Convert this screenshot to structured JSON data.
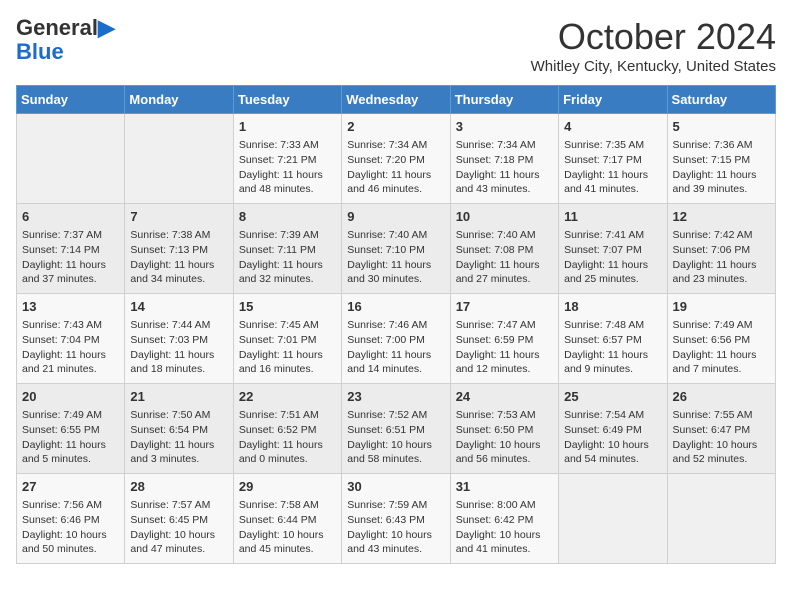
{
  "header": {
    "logo_general": "General",
    "logo_blue": "Blue",
    "month": "October 2024",
    "location": "Whitley City, Kentucky, United States"
  },
  "days_of_week": [
    "Sunday",
    "Monday",
    "Tuesday",
    "Wednesday",
    "Thursday",
    "Friday",
    "Saturday"
  ],
  "weeks": [
    [
      {
        "day": "",
        "info": ""
      },
      {
        "day": "",
        "info": ""
      },
      {
        "day": "1",
        "info": "Sunrise: 7:33 AM\nSunset: 7:21 PM\nDaylight: 11 hours\nand 48 minutes."
      },
      {
        "day": "2",
        "info": "Sunrise: 7:34 AM\nSunset: 7:20 PM\nDaylight: 11 hours\nand 46 minutes."
      },
      {
        "day": "3",
        "info": "Sunrise: 7:34 AM\nSunset: 7:18 PM\nDaylight: 11 hours\nand 43 minutes."
      },
      {
        "day": "4",
        "info": "Sunrise: 7:35 AM\nSunset: 7:17 PM\nDaylight: 11 hours\nand 41 minutes."
      },
      {
        "day": "5",
        "info": "Sunrise: 7:36 AM\nSunset: 7:15 PM\nDaylight: 11 hours\nand 39 minutes."
      }
    ],
    [
      {
        "day": "6",
        "info": "Sunrise: 7:37 AM\nSunset: 7:14 PM\nDaylight: 11 hours\nand 37 minutes."
      },
      {
        "day": "7",
        "info": "Sunrise: 7:38 AM\nSunset: 7:13 PM\nDaylight: 11 hours\nand 34 minutes."
      },
      {
        "day": "8",
        "info": "Sunrise: 7:39 AM\nSunset: 7:11 PM\nDaylight: 11 hours\nand 32 minutes."
      },
      {
        "day": "9",
        "info": "Sunrise: 7:40 AM\nSunset: 7:10 PM\nDaylight: 11 hours\nand 30 minutes."
      },
      {
        "day": "10",
        "info": "Sunrise: 7:40 AM\nSunset: 7:08 PM\nDaylight: 11 hours\nand 27 minutes."
      },
      {
        "day": "11",
        "info": "Sunrise: 7:41 AM\nSunset: 7:07 PM\nDaylight: 11 hours\nand 25 minutes."
      },
      {
        "day": "12",
        "info": "Sunrise: 7:42 AM\nSunset: 7:06 PM\nDaylight: 11 hours\nand 23 minutes."
      }
    ],
    [
      {
        "day": "13",
        "info": "Sunrise: 7:43 AM\nSunset: 7:04 PM\nDaylight: 11 hours\nand 21 minutes."
      },
      {
        "day": "14",
        "info": "Sunrise: 7:44 AM\nSunset: 7:03 PM\nDaylight: 11 hours\nand 18 minutes."
      },
      {
        "day": "15",
        "info": "Sunrise: 7:45 AM\nSunset: 7:01 PM\nDaylight: 11 hours\nand 16 minutes."
      },
      {
        "day": "16",
        "info": "Sunrise: 7:46 AM\nSunset: 7:00 PM\nDaylight: 11 hours\nand 14 minutes."
      },
      {
        "day": "17",
        "info": "Sunrise: 7:47 AM\nSunset: 6:59 PM\nDaylight: 11 hours\nand 12 minutes."
      },
      {
        "day": "18",
        "info": "Sunrise: 7:48 AM\nSunset: 6:57 PM\nDaylight: 11 hours\nand 9 minutes."
      },
      {
        "day": "19",
        "info": "Sunrise: 7:49 AM\nSunset: 6:56 PM\nDaylight: 11 hours\nand 7 minutes."
      }
    ],
    [
      {
        "day": "20",
        "info": "Sunrise: 7:49 AM\nSunset: 6:55 PM\nDaylight: 11 hours\nand 5 minutes."
      },
      {
        "day": "21",
        "info": "Sunrise: 7:50 AM\nSunset: 6:54 PM\nDaylight: 11 hours\nand 3 minutes."
      },
      {
        "day": "22",
        "info": "Sunrise: 7:51 AM\nSunset: 6:52 PM\nDaylight: 11 hours\nand 0 minutes."
      },
      {
        "day": "23",
        "info": "Sunrise: 7:52 AM\nSunset: 6:51 PM\nDaylight: 10 hours\nand 58 minutes."
      },
      {
        "day": "24",
        "info": "Sunrise: 7:53 AM\nSunset: 6:50 PM\nDaylight: 10 hours\nand 56 minutes."
      },
      {
        "day": "25",
        "info": "Sunrise: 7:54 AM\nSunset: 6:49 PM\nDaylight: 10 hours\nand 54 minutes."
      },
      {
        "day": "26",
        "info": "Sunrise: 7:55 AM\nSunset: 6:47 PM\nDaylight: 10 hours\nand 52 minutes."
      }
    ],
    [
      {
        "day": "27",
        "info": "Sunrise: 7:56 AM\nSunset: 6:46 PM\nDaylight: 10 hours\nand 50 minutes."
      },
      {
        "day": "28",
        "info": "Sunrise: 7:57 AM\nSunset: 6:45 PM\nDaylight: 10 hours\nand 47 minutes."
      },
      {
        "day": "29",
        "info": "Sunrise: 7:58 AM\nSunset: 6:44 PM\nDaylight: 10 hours\nand 45 minutes."
      },
      {
        "day": "30",
        "info": "Sunrise: 7:59 AM\nSunset: 6:43 PM\nDaylight: 10 hours\nand 43 minutes."
      },
      {
        "day": "31",
        "info": "Sunrise: 8:00 AM\nSunset: 6:42 PM\nDaylight: 10 hours\nand 41 minutes."
      },
      {
        "day": "",
        "info": ""
      },
      {
        "day": "",
        "info": ""
      }
    ]
  ]
}
